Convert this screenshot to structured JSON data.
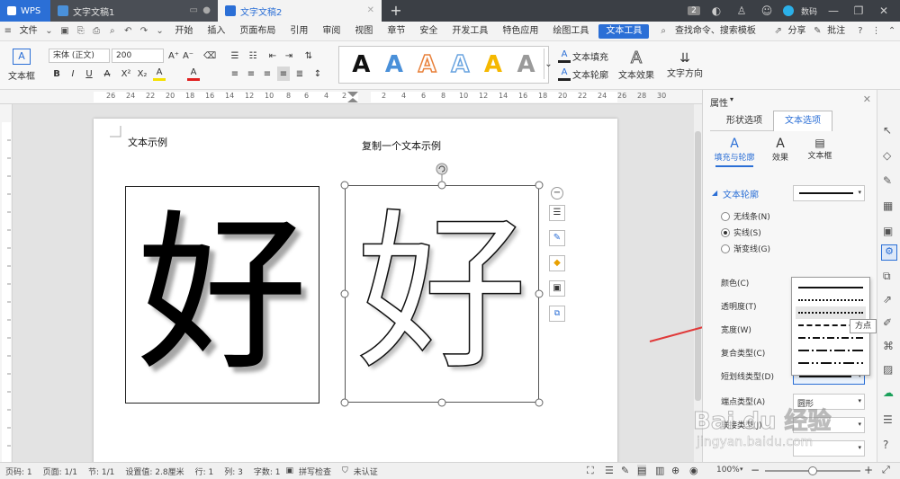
{
  "titlebar": {
    "app_tab": "WPS",
    "tabs": [
      {
        "label": "文字文稿1"
      },
      {
        "label": "文字文稿2"
      }
    ],
    "user_name": "数码"
  },
  "menubar": {
    "file": "文件",
    "items": [
      "开始",
      "插入",
      "页面布局",
      "引用",
      "审阅",
      "视图",
      "章节",
      "安全",
      "开发工具",
      "特色应用",
      "绘图工具"
    ],
    "active": "文本工具",
    "search": "查找命令、搜索模板",
    "share": "分享",
    "comment": "批注"
  },
  "ribbon": {
    "textbox": "文本框",
    "font_name": "宋体 (正文)",
    "font_size": "200",
    "text_fill": "文本填充",
    "text_outline": "文本轮廓",
    "text_effect": "文本效果",
    "text_direction": "文字方向",
    "art_styles": [
      {
        "color": "#111111",
        "style": "solid"
      },
      {
        "color": "#4a90d9",
        "style": "solid"
      },
      {
        "color": "#e8a66a",
        "style": "outline-orange"
      },
      {
        "color": "#6aa4e0",
        "style": "outline"
      },
      {
        "color": "#f5b800",
        "style": "solid"
      },
      {
        "color": "#8a8a8a",
        "style": "gradient"
      }
    ]
  },
  "ruler": {
    "numbers": [
      "26",
      "24",
      "22",
      "20",
      "18",
      "16",
      "14",
      "12",
      "10",
      "8",
      "6",
      "4",
      "2",
      "",
      "2",
      "4",
      "6",
      "8",
      "10",
      "12",
      "14",
      "16",
      "18",
      "20",
      "22",
      "24",
      "26",
      "28",
      "30"
    ]
  },
  "document": {
    "label_left": "文本示例",
    "label_right": "复制一个文本示例",
    "glyph": "好"
  },
  "float_toolbar_icons": [
    "minus-icon",
    "layout-icon",
    "pen-icon",
    "fill-icon",
    "frame-icon",
    "group-icon"
  ],
  "panel": {
    "title": "属性",
    "tabs": [
      "形状选项",
      "文本选项"
    ],
    "active_tab": "文本选项",
    "subtabs": [
      "填充与轮廓",
      "效果",
      "文本框"
    ],
    "section": "文本轮廓",
    "radios": [
      {
        "label": "无线条(N)",
        "checked": false
      },
      {
        "label": "实线(S)",
        "checked": true
      },
      {
        "label": "渐变线(G)",
        "checked": false
      }
    ],
    "props": [
      {
        "label": "颜色(C)"
      },
      {
        "label": "透明度(T)"
      },
      {
        "label": "宽度(W)"
      },
      {
        "label": "复合类型(C)"
      },
      {
        "label": "短划线类型(D)"
      },
      {
        "label": "端点类型(A)",
        "value": "圆形"
      },
      {
        "label": "联接类型(J)"
      }
    ],
    "tooltip": "方点",
    "dash_options": [
      "solid",
      "round-dot",
      "square-dot",
      "dash",
      "dash-dot",
      "long-dash-dot",
      "long-dash-dot-dot"
    ]
  },
  "status": {
    "page_num": "页码: 1",
    "pages": "页面: 1/1",
    "section": "节: 1/1",
    "setting": "设置值: 2.8厘米",
    "row": "行: 1",
    "col": "列: 3",
    "words": "字数: 1",
    "spell": "拼写检查",
    "cert": "未认证",
    "zoom": "100%"
  },
  "watermark": {
    "logo": "Bai du 经验",
    "url": "jingyan.baidu.com"
  },
  "colors": {
    "accent": "#2b6fd6",
    "arrow": "#e03a3a"
  }
}
